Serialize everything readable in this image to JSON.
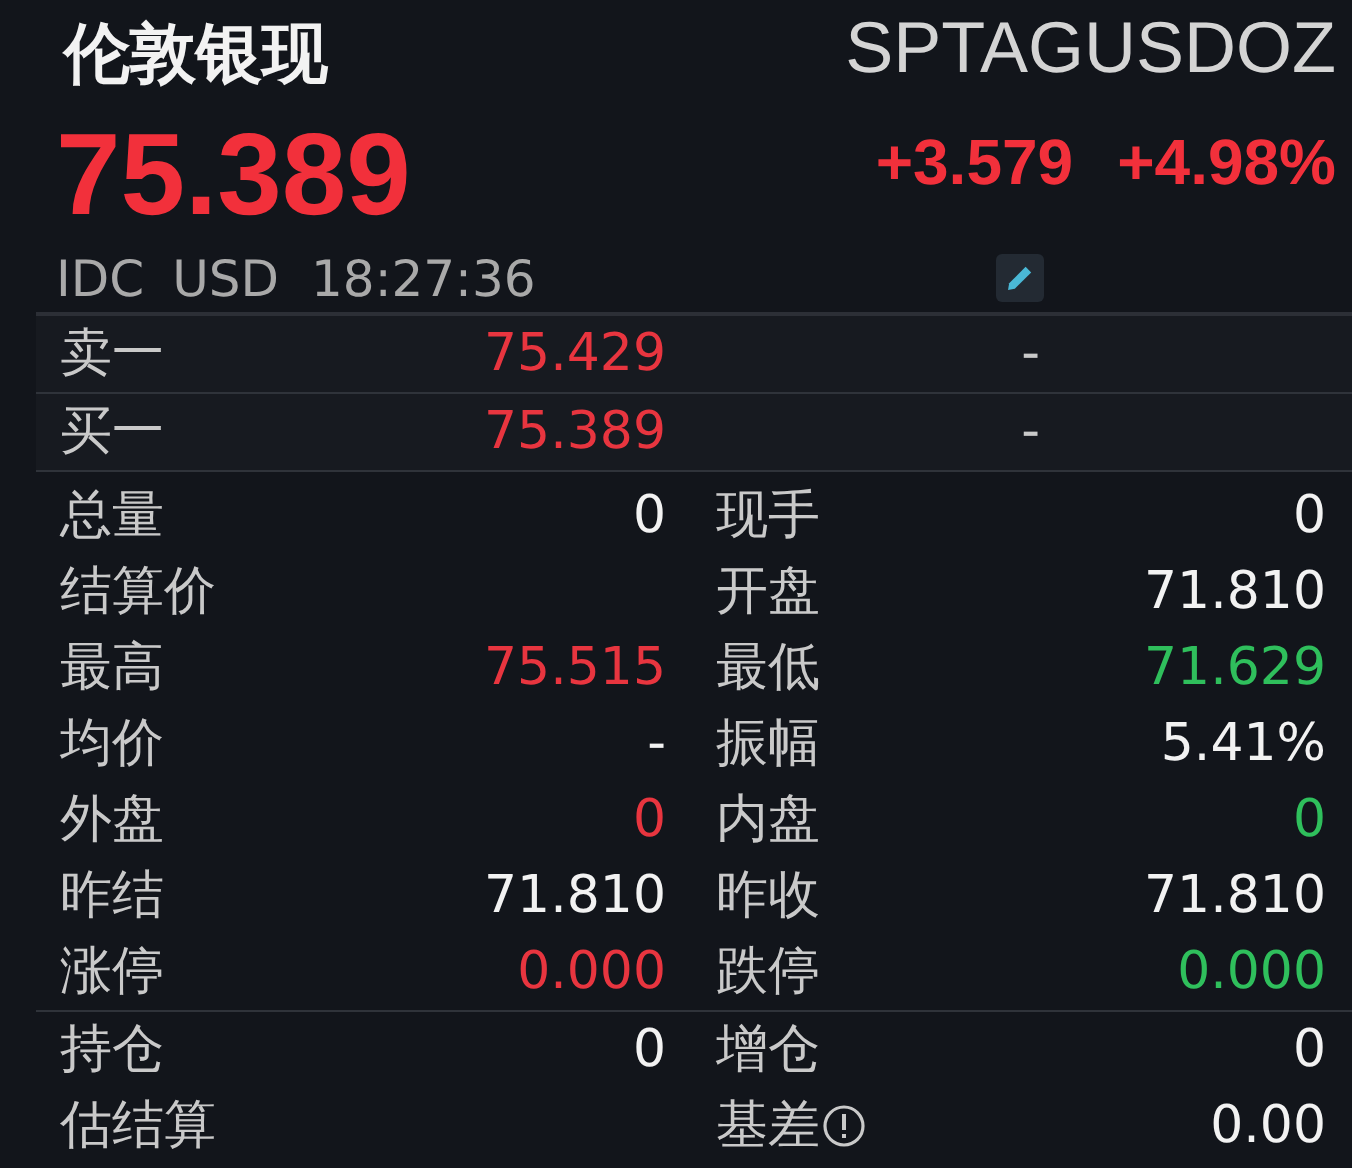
{
  "header": {
    "name": "伦敦银现",
    "code": "SPTAGUSDOZ",
    "price": "75.389",
    "change": "+3.579",
    "change_pct": "+4.98%",
    "exchange": "IDC",
    "currency": "USD",
    "time": "18:27:36",
    "color": "#f2303b"
  },
  "order_book": [
    {
      "label": "卖一",
      "price": "75.429",
      "volume": "-",
      "color": "#e8353f"
    },
    {
      "label": "买一",
      "price": "75.389",
      "volume": "-",
      "color": "#e8353f"
    }
  ],
  "sections": [
    [
      [
        {
          "label": "总量",
          "value": "0",
          "color": "#f2f2f2"
        },
        {
          "label": "现手",
          "value": "0",
          "color": "#f2f2f2"
        }
      ],
      [
        {
          "label": "结算价"
        },
        {
          "label": "开盘",
          "value": "71.810",
          "color": "#f2f2f2"
        }
      ],
      [
        {
          "label": "最高",
          "value": "75.515",
          "color": "#e8353f"
        },
        {
          "label": "最低",
          "value": "71.629",
          "color": "#2fbf5c"
        }
      ],
      [
        {
          "label": "均价",
          "value": "-",
          "color": "#f2f2f2"
        },
        {
          "label": "振幅",
          "value": "5.41%",
          "color": "#f2f2f2"
        }
      ],
      [
        {
          "label": "外盘",
          "value": "0",
          "color": "#e8353f"
        },
        {
          "label": "内盘",
          "value": "0",
          "color": "#2fbf5c"
        }
      ],
      [
        {
          "label": "昨结",
          "value": "71.810",
          "color": "#f2f2f2"
        },
        {
          "label": "昨收",
          "value": "71.810",
          "color": "#f2f2f2"
        }
      ],
      [
        {
          "label": "涨停",
          "value": "0.000",
          "color": "#e8353f"
        },
        {
          "label": "跌停",
          "value": "0.000",
          "color": "#2fbf5c"
        }
      ]
    ],
    [
      [
        {
          "label": "持仓",
          "value": "0",
          "color": "#f2f2f2"
        },
        {
          "label": "增仓",
          "value": "0",
          "color": "#f2f2f2"
        }
      ],
      [
        {
          "label": "估结算"
        },
        {
          "label": "基差",
          "info": true,
          "value": "0.00",
          "color": "#f2f2f2"
        }
      ]
    ]
  ]
}
